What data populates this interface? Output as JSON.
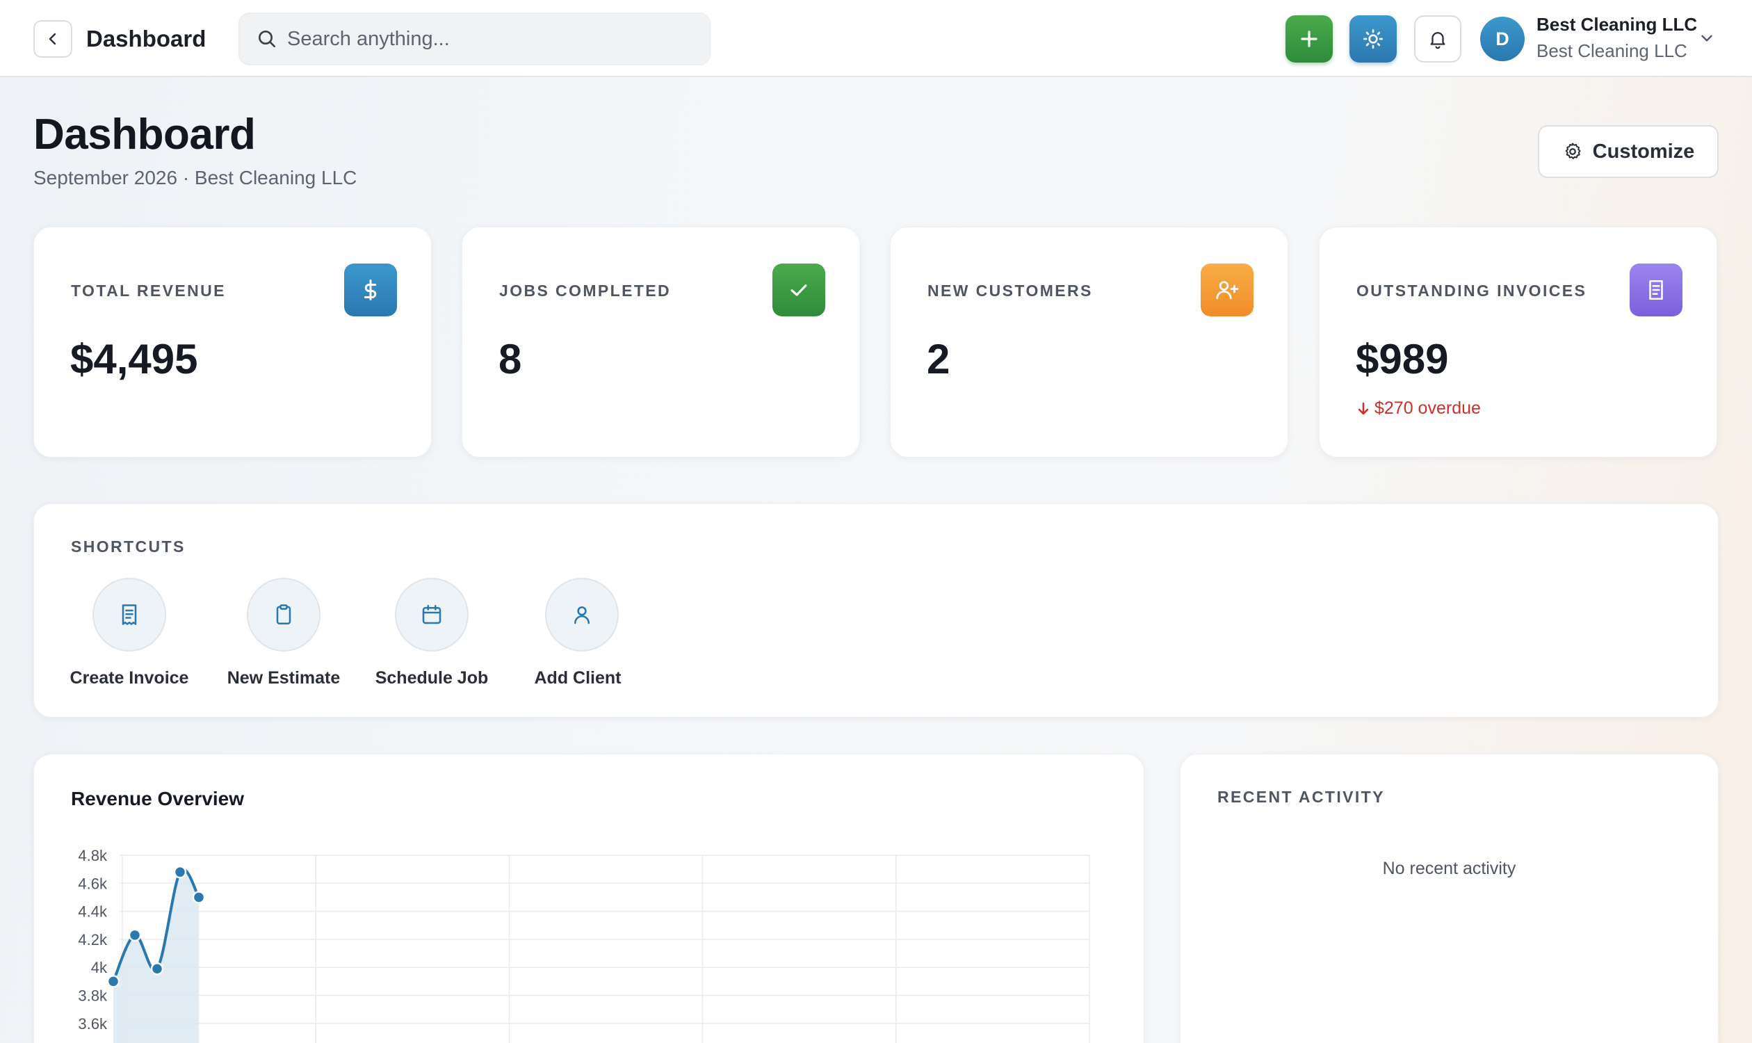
{
  "topbar": {
    "title": "Dashboard",
    "search_placeholder": "Search anything...",
    "account": {
      "initial": "D",
      "name": "Best Cleaning LLC",
      "business": "Best Cleaning LLC"
    }
  },
  "header": {
    "title": "Dashboard",
    "subtitle": "September 2026 · Best Cleaning LLC",
    "customize_label": "Customize"
  },
  "stats": [
    {
      "label": "TOTAL REVENUE",
      "value": "$4,495",
      "icon": "dollar-icon",
      "color": "#2f86bf"
    },
    {
      "label": "JOBS COMPLETED",
      "value": "8",
      "icon": "check-icon",
      "color": "#389a44"
    },
    {
      "label": "NEW CUSTOMERS",
      "value": "2",
      "icon": "user-plus-icon",
      "color": "#f4a038"
    },
    {
      "label": "OUTSTANDING INVOICES",
      "value": "$989",
      "icon": "invoice-icon",
      "color": "#8a73e6",
      "note": "$270 overdue"
    }
  ],
  "shortcuts": {
    "title": "SHORTCUTS",
    "items": [
      {
        "label": "Create Invoice",
        "icon": "receipt-icon"
      },
      {
        "label": "New Estimate",
        "icon": "clipboard-icon"
      },
      {
        "label": "Schedule Job",
        "icon": "calendar-icon"
      },
      {
        "label": "Add Client",
        "icon": "user-icon"
      }
    ]
  },
  "revenue": {
    "title": "Revenue Overview"
  },
  "chart_data": {
    "type": "area",
    "title": "Revenue Overview",
    "y_ticks": [
      "4.8k",
      "4.6k",
      "4.4k",
      "4.2k",
      "4k",
      "3.8k",
      "3.6k"
    ],
    "ylim": [
      3500,
      4800
    ],
    "x_gridlines": 6,
    "series": [
      {
        "values": [
          3900,
          4230,
          3990,
          4680,
          4500
        ]
      }
    ],
    "color": "#2a78b0",
    "grid": true
  },
  "activity": {
    "title": "RECENT ACTIVITY",
    "empty": "No recent activity"
  }
}
